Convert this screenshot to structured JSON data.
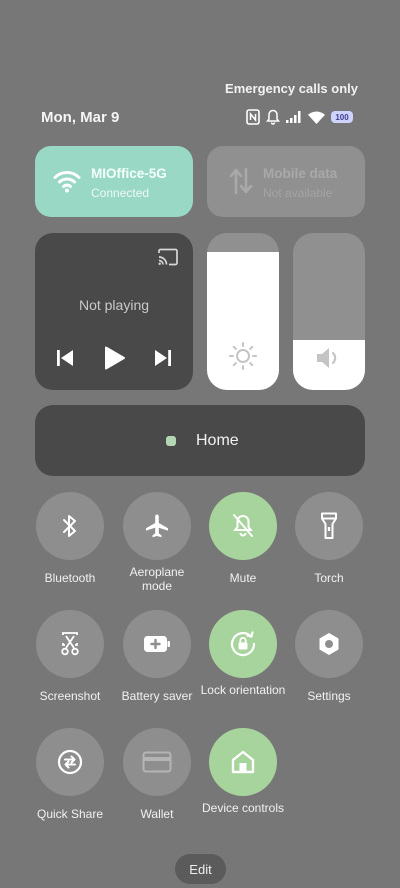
{
  "status_bar": {
    "emergency": "Emergency calls only",
    "date": "Mon, Mar 9",
    "battery": "100",
    "icons": [
      "nfc-icon",
      "bell-icon",
      "signal-icon",
      "wifi-icon",
      "battery-icon"
    ]
  },
  "wifi_tile": {
    "title": "MIOffice-5G",
    "subtitle": "Connected",
    "active": true,
    "color": "#99d8c4"
  },
  "mobile_tile": {
    "title": "Mobile data",
    "subtitle": "Not available",
    "active": false
  },
  "media": {
    "status": "Not playing",
    "controls": [
      "previous",
      "play",
      "next"
    ]
  },
  "brightness": {
    "level": 0.88
  },
  "volume": {
    "level": 0.32
  },
  "home": {
    "label": "Home"
  },
  "quick_settings": [
    {
      "label": "Bluetooth",
      "icon": "bluetooth-icon",
      "active": false
    },
    {
      "label": "Aeroplane mode",
      "icon": "airplane-icon",
      "active": false
    },
    {
      "label": "Mute",
      "icon": "mute-bell-icon",
      "active": true
    },
    {
      "label": "Torch",
      "icon": "flashlight-icon",
      "active": false
    },
    {
      "label": "Screenshot",
      "icon": "scissors-icon",
      "active": false
    },
    {
      "label": "Battery saver",
      "icon": "battery-plus-icon",
      "active": false
    },
    {
      "label": "Lock orientation",
      "icon": "lock-rotation-icon",
      "active": true
    },
    {
      "label": "Settings",
      "icon": "settings-hex-icon",
      "active": false
    },
    {
      "label": "Quick Share",
      "icon": "share-arrows-icon",
      "active": false
    },
    {
      "label": "Wallet",
      "icon": "wallet-card-icon",
      "active": false
    },
    {
      "label": "Device controls",
      "icon": "home-icon",
      "active": true
    }
  ],
  "edit_label": "Edit",
  "colors": {
    "background": "#777777",
    "active_tile": "#a7d49d",
    "inactive_tile": "#8e8e8e",
    "dark_panel": "#494949"
  }
}
